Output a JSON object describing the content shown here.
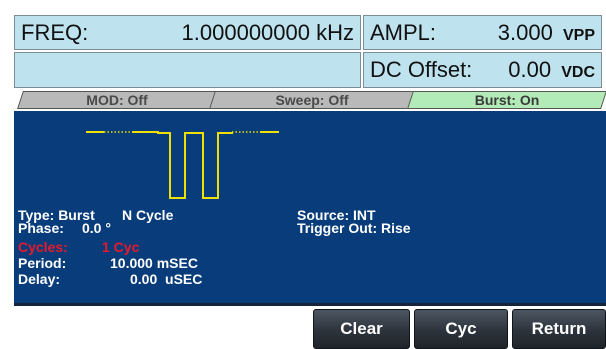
{
  "header": {
    "freq_label": "FREQ:",
    "freq_value": "1.000000000 kHz",
    "ampl_label": "AMPL:",
    "ampl_value": "3.000",
    "ampl_unit": "VPP",
    "offset_label": "DC Offset:",
    "offset_value": "0.00",
    "offset_unit": "VDC"
  },
  "tabs": [
    {
      "label": "MOD: Off",
      "active": false
    },
    {
      "label": "Sweep: Off",
      "active": false
    },
    {
      "label": "Burst: On",
      "active": true
    }
  ],
  "burst": {
    "type_label": "Type: Burst",
    "type_value": "N Cycle",
    "phase_label": "Phase:",
    "phase_value": "0.0 °",
    "cycles_label": "Cycles:",
    "cycles_value": "1 Cyc",
    "period_label": "Period:",
    "period_value": "10.000 mSEC",
    "delay_label": "Delay:",
    "delay_value": "0.00  uSEC",
    "source": "Source: INT",
    "trigger_out": "Trigger Out: Rise"
  },
  "softkeys": [
    "Clear",
    "Cyc",
    "Return"
  ],
  "colors": {
    "info_bg": "#bfe3ee",
    "panel_bg": "#083c7a",
    "waveform": "#f0e000",
    "highlight_text": "#e8192c",
    "active_tab": "#b2ebb7",
    "inactive_tab": "#b9b9b9"
  }
}
